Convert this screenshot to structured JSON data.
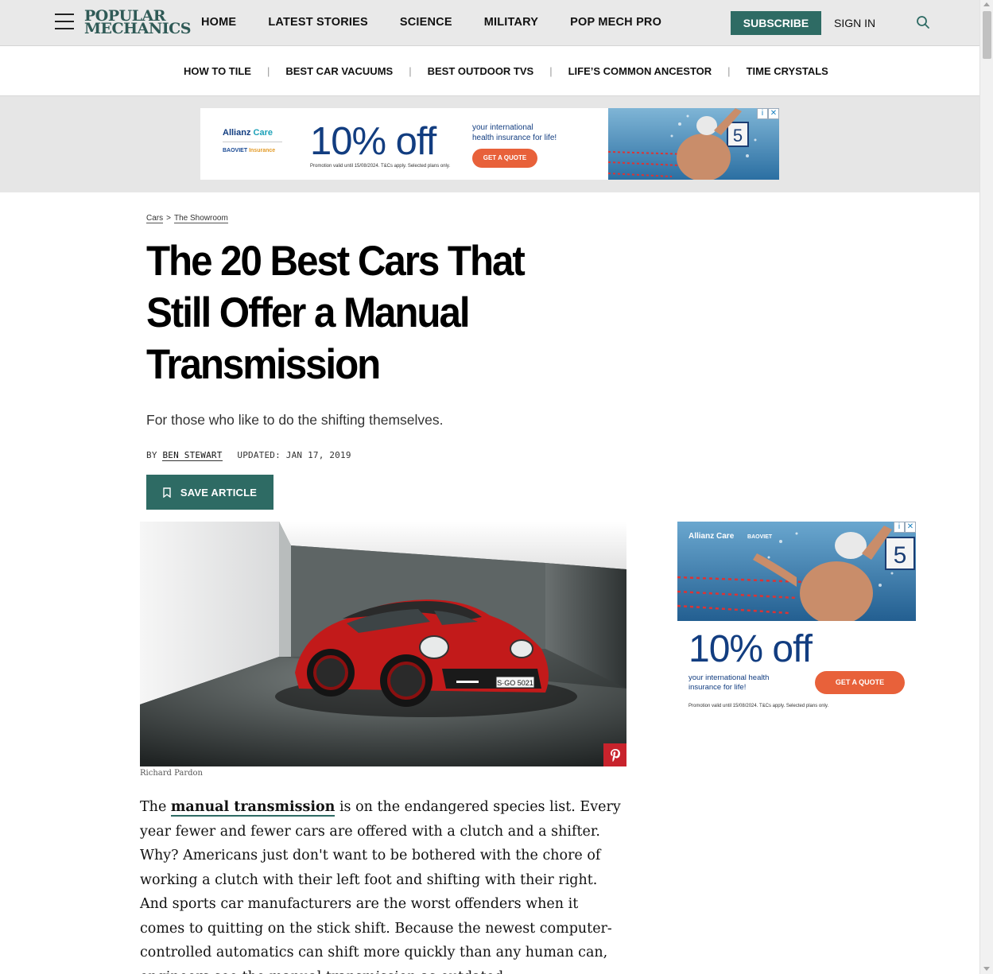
{
  "header": {
    "logo_line1": "POPULAR",
    "logo_line2": "MECHANICS",
    "nav": [
      "HOME",
      "LATEST STORIES",
      "SCIENCE",
      "MILITARY",
      "POP MECH PRO"
    ],
    "subscribe_label": "SUBSCRIBE",
    "signin_label": "SIGN IN"
  },
  "trending": [
    "HOW TO TILE",
    "BEST CAR VACUUMS",
    "BEST OUTDOOR TVS",
    "LIFE’S COMMON ANCESTOR",
    "TIME CRYSTALS"
  ],
  "leaderboard_ad": {
    "brand1": "Allianz",
    "brand1b": "Care",
    "brand2": "BAOVIET",
    "brand2b": "Insurance",
    "headline": "10% off",
    "tagline_1": "your international",
    "tagline_2": "health insurance for life!",
    "cta": "GET A QUOTE",
    "fine_print": "Promotion valid until 15/08/2024. T&Cs apply. Selected plans only.",
    "lane_number": "5"
  },
  "breadcrumb": [
    "Cars",
    "The Showroom"
  ],
  "article": {
    "headline": "The 20 Best Cars That Still Offer a Manual Transmission",
    "dek": "For those who like to do the shifting themselves.",
    "by_label": "BY",
    "author": "BEN STEWART",
    "updated": "UPDATED: JAN 17, 2019",
    "save_label": "SAVE ARTICLE",
    "image_credit": "Richard Pardon",
    "plate": "S·GO 5021",
    "body_lead": "The ",
    "body_link": "manual transmission",
    "body_rest": " is on the endangered species list. Every year fewer and fewer cars are offered with a clutch and a shifter. Why? Americans just don't want to be bothered with the chore of working a clutch with their left foot and shifting with their right. And sports car manufacturers are the worst offenders when it comes to quitting on the stick shift. Because the newest computer-controlled automatics can shift more quickly than any human can, engineers see the manual transmission as outdated."
  },
  "side_ad": {
    "brand1": "Allianz",
    "brand1b": "Care",
    "brand2": "BAOVIET",
    "headline": "10% off",
    "tagline_1": "your international health",
    "tagline_2": "insurance for life!",
    "cta": "GET A QUOTE",
    "fine_print": "Promotion valid until 15/08/2024. T&Cs apply. Selected plans only.",
    "lane_number": "5"
  },
  "colors": {
    "brand_green": "#2e6b64",
    "logo_green": "#2f5a56",
    "ad_blue": "#123d80",
    "ad_orange": "#e8613a",
    "pinterest": "#c8232c"
  },
  "icons": [
    "menu-icon",
    "search-icon",
    "bookmark-icon",
    "pinterest-icon",
    "adchoices-icon",
    "close-icon"
  ]
}
